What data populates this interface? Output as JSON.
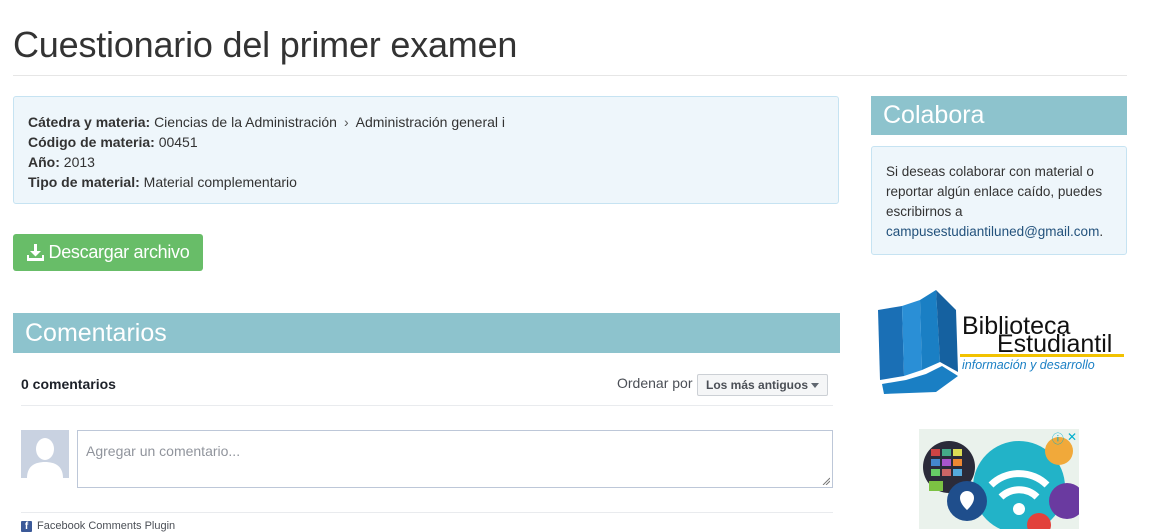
{
  "page": {
    "title": "Cuestionario del primer examen"
  },
  "info": {
    "catedra_label": "Cátedra y materia:",
    "catedra": "Ciencias de la Administración",
    "crumb_sep": "›",
    "materia": "Administración general i",
    "codigo_label": "Código de materia:",
    "codigo": "00451",
    "anio_label": "Año:",
    "anio": "2013",
    "tipo_label": "Tipo de material:",
    "tipo": "Material complementario"
  },
  "download": {
    "label": "Descargar archivo",
    "icon": "download-icon"
  },
  "comments": {
    "header": "Comentarios",
    "count": "0 comentarios",
    "sort_label": "Ordenar por",
    "sort_value": "Los más antiguos",
    "placeholder": "Agregar un comentario...",
    "plugin_label": "Facebook Comments Plugin"
  },
  "sidebar": {
    "colabora_header": "Colabora",
    "colabora_text": "Si deseas colaborar con material o reportar algún enlace caído, puedes escribirnos a",
    "email": "campusestudiantiluned@gmail.com",
    "after_email": ".",
    "logo": {
      "line1": "Biblioteca",
      "line2": "Estudiantil",
      "tagline": "información y desarrollo"
    }
  },
  "colors": {
    "section_header": "#8dc3cd",
    "info_bg": "#eef6fb",
    "download_btn": "#5cb85c",
    "link": "#23527c",
    "logo_blue": "#1a7fc4",
    "logo_yellow": "#f2c200"
  }
}
